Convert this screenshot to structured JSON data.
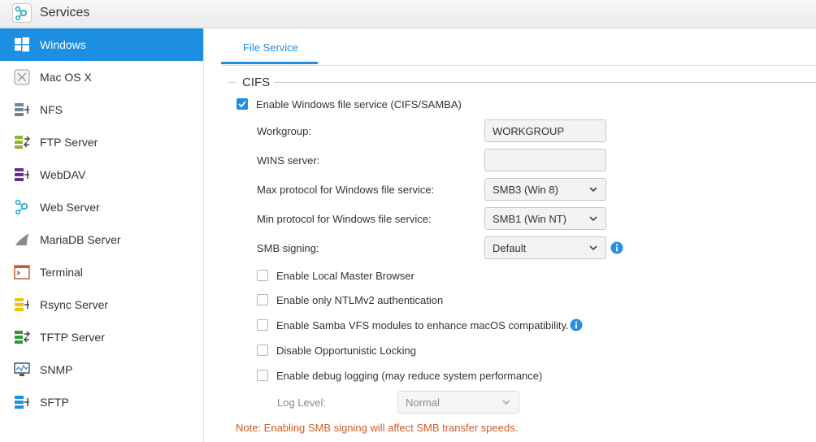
{
  "window": {
    "title": "Services",
    "icon": "services-icon"
  },
  "sidebar": {
    "items": [
      {
        "label": "Windows",
        "icon": "windows-icon",
        "active": true
      },
      {
        "label": "Mac OS X",
        "icon": "macos-icon"
      },
      {
        "label": "NFS",
        "icon": "nfs-icon"
      },
      {
        "label": "FTP Server",
        "icon": "ftp-icon"
      },
      {
        "label": "WebDAV",
        "icon": "webdav-icon"
      },
      {
        "label": "Web Server",
        "icon": "web-server-icon"
      },
      {
        "label": "MariaDB Server",
        "icon": "mariadb-icon"
      },
      {
        "label": "Terminal",
        "icon": "terminal-icon"
      },
      {
        "label": "Rsync Server",
        "icon": "rsync-icon"
      },
      {
        "label": "TFTP Server",
        "icon": "tftp-icon"
      },
      {
        "label": "SNMP",
        "icon": "snmp-icon"
      },
      {
        "label": "SFTP",
        "icon": "sftp-icon"
      }
    ]
  },
  "tabs": [
    {
      "label": "File Service",
      "active": true
    }
  ],
  "cifs": {
    "section_title": "CIFS",
    "enable_label": "Enable Windows file service (CIFS/SAMBA)",
    "enable_checked": true,
    "workgroup_label": "Workgroup:",
    "workgroup_value": "WORKGROUP",
    "wins_label": "WINS server:",
    "wins_value": "",
    "max_protocol_label": "Max protocol for Windows file service:",
    "max_protocol_value": "SMB3 (Win 8)",
    "min_protocol_label": "Min protocol for Windows file service:",
    "min_protocol_value": "SMB1 (Win NT)",
    "smb_signing_label": "SMB signing:",
    "smb_signing_value": "Default",
    "options": [
      {
        "label": "Enable Local Master Browser",
        "checked": false
      },
      {
        "label": "Enable only NTLMv2 authentication",
        "checked": false
      },
      {
        "label": "Enable Samba VFS modules to enhance macOS compatibility.",
        "checked": false
      },
      {
        "label": "Disable Opportunistic Locking",
        "checked": false
      },
      {
        "label": "Enable debug logging (may reduce system performance)",
        "checked": false
      }
    ],
    "log_level_label": "Log Level:",
    "log_level_value": "Normal",
    "note": "Note: Enabling SMB signing will affect SMB transfer speeds."
  },
  "colors": {
    "accent": "#1c8fe3",
    "note": "#d05b24",
    "info": "#2a8fe0"
  }
}
